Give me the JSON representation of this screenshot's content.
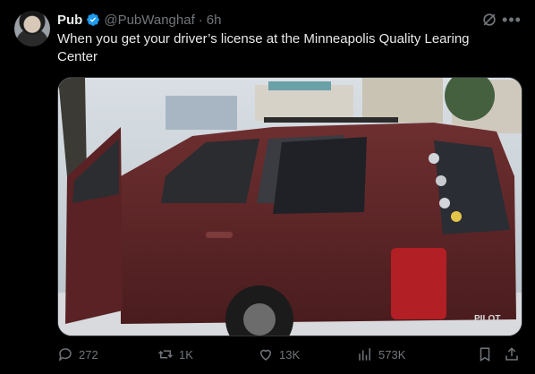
{
  "user": {
    "display_name": "Pub",
    "handle": "@PubWanghaf",
    "separator": "·",
    "time": "6h"
  },
  "tweet": {
    "text": "When you get your driver’s license at the Minneapolis Quality Learing Center"
  },
  "media": {
    "car_badge": "PILOT",
    "description_icon": "car-photo"
  },
  "actions": {
    "replies": "272",
    "reposts": "1K",
    "likes": "13K",
    "views": "573K"
  },
  "colors": {
    "background": "#000000",
    "text": "#e7e9ea",
    "muted": "#71767b",
    "verified": "#1d9bf0"
  }
}
